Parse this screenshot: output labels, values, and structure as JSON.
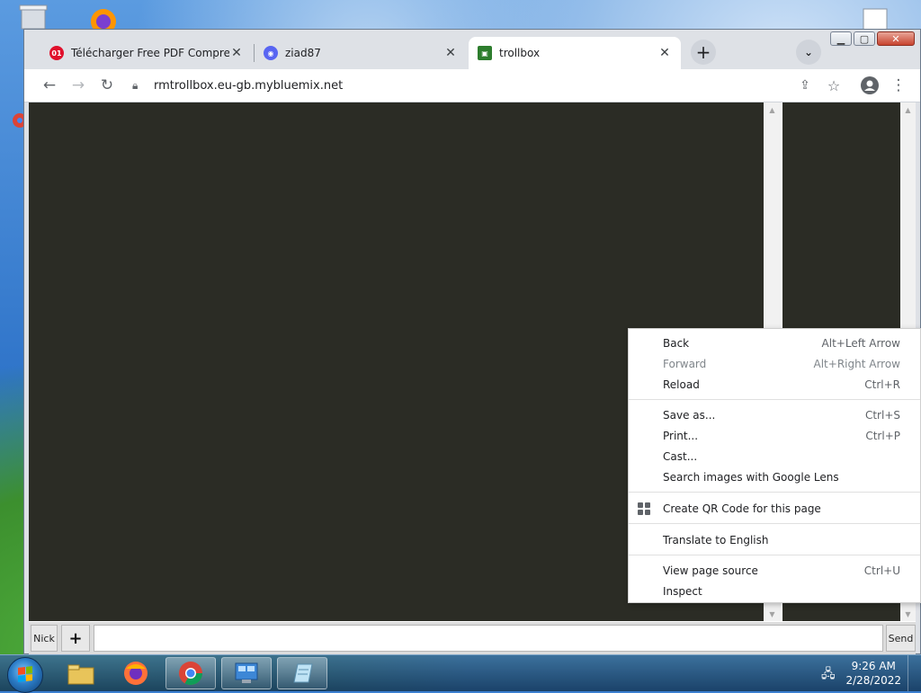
{
  "browser": {
    "tabs": [
      {
        "title": "Télécharger Free PDF Compressor",
        "favicon": "opera-icon",
        "active": false
      },
      {
        "title": "ziad87",
        "favicon": "discord-icon",
        "active": false
      },
      {
        "title": "trollbox",
        "favicon": "trollbox-icon",
        "active": true
      }
    ],
    "url": "rmtrollbox.eu-gb.mybluemix.net"
  },
  "page": {
    "nick_label": "Nick",
    "plus_label": "+",
    "send_label": "Send",
    "message_placeholder": ""
  },
  "context_menu": {
    "groups": [
      [
        {
          "label": "Back",
          "shortcut": "Alt+Left Arrow",
          "enabled": true
        },
        {
          "label": "Forward",
          "shortcut": "Alt+Right Arrow",
          "enabled": false
        },
        {
          "label": "Reload",
          "shortcut": "Ctrl+R",
          "enabled": true
        }
      ],
      [
        {
          "label": "Save as...",
          "shortcut": "Ctrl+S",
          "enabled": true
        },
        {
          "label": "Print...",
          "shortcut": "Ctrl+P",
          "enabled": true
        },
        {
          "label": "Cast...",
          "shortcut": "",
          "enabled": true
        },
        {
          "label": "Search images with Google Lens",
          "shortcut": "",
          "enabled": true
        }
      ],
      [
        {
          "label": "Create QR Code for this page",
          "shortcut": "",
          "enabled": true,
          "icon": "qr-code-icon"
        }
      ],
      [
        {
          "label": "Translate to English",
          "shortcut": "",
          "enabled": true
        }
      ],
      [
        {
          "label": "View page source",
          "shortcut": "Ctrl+U",
          "enabled": true
        },
        {
          "label": "Inspect",
          "shortcut": "",
          "enabled": true
        }
      ]
    ]
  },
  "taskbar": {
    "apps": [
      "explorer-icon",
      "firefox-icon",
      "chrome-icon",
      "control-panel-icon",
      "notepad-icon"
    ],
    "time": "9:26 AM",
    "date": "2/28/2022"
  },
  "colors": {
    "page_dark": "#2b2c25",
    "tab_bar": "#dee1e6"
  }
}
